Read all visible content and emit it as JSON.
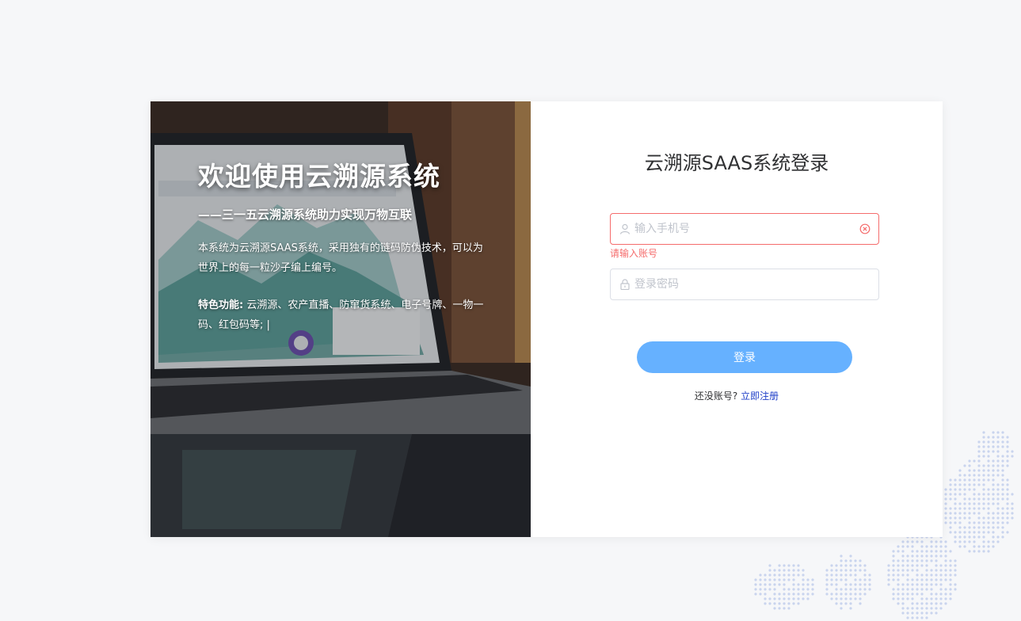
{
  "hero": {
    "title": "欢迎使用云溯源系统",
    "subtitle": "——三一五云溯源系统助力实现万物互联",
    "description": "本系统为云溯源SAAS系统，采用独有的链码防伪技术，可以为世界上的每一粒沙子编上编号。",
    "features_label": "特色功能:",
    "features_text": " 云溯源、农产直播、防窜货系统、电子号牌、一物一码、红包码等; |"
  },
  "login_form": {
    "title": "云溯源SAAS系统登录",
    "username": {
      "value": "",
      "placeholder": "输入手机号",
      "prefix_icon": "user-icon",
      "suffix_icon": "clear-circle-icon",
      "error": "请输入账号"
    },
    "password": {
      "value": "",
      "placeholder": "登录密码",
      "prefix_icon": "lock-icon"
    },
    "submit_label": "登录",
    "register_prompt": "还没账号?",
    "register_link": "立即注册"
  },
  "colors": {
    "accent": "#66b1ff",
    "error": "#f56c6c",
    "link": "#1e3ec8",
    "background": "#f6f7f9"
  }
}
